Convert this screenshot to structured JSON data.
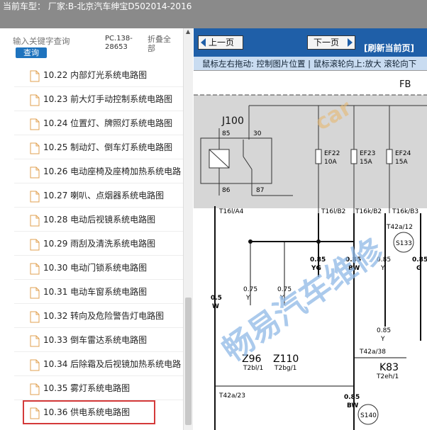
{
  "header": {
    "title": "当前车型：  厂家:B-北京汽车绅宝D502014-2016"
  },
  "search": {
    "placeholder": "输入关键字查询",
    "button": "查询",
    "pc_label": "PC.138-28653",
    "fold_label": "折叠全部"
  },
  "tree": {
    "items": [
      {
        "label": "10.22  内部灯光系统电路图"
      },
      {
        "label": "10.23  前大灯手动控制系统电路图"
      },
      {
        "label": "10.24  位置灯、牌照灯系统电路图"
      },
      {
        "label": "10.25  制动灯、倒车灯系统电路图"
      },
      {
        "label": "10.26  电动座椅及座椅加热系统电路"
      },
      {
        "label": "10.27  喇叭、点烟器系统电路图"
      },
      {
        "label": "10.28  电动后视镜系统电路图"
      },
      {
        "label": "10.29  雨刮及清洗系统电路图"
      },
      {
        "label": "10.30  电动门锁系统电路图"
      },
      {
        "label": "10.31  电动车窗系统电路图"
      },
      {
        "label": "10.32  转向及危险警告灯电路图"
      },
      {
        "label": "10.33  倒车雷达系统电路图"
      },
      {
        "label": "10.34  后除霜及后视镜加热系统电路"
      },
      {
        "label": "10.35  雾灯系统电路图"
      },
      {
        "label": "10.36  供电系统电路图"
      }
    ],
    "selected_index": 14
  },
  "viewer": {
    "prev": "上一页",
    "next": "下一页",
    "refresh": "[刷新当前页]",
    "hint": "鼠标左右拖动: 控制图片位置 | 鼠标滚轮向上:放大  滚轮向下"
  },
  "diagram": {
    "fb": "FB",
    "relay": "J100",
    "relay_pins": [
      "85",
      "30",
      "86",
      "87"
    ],
    "fuses": [
      {
        "name": "EF22",
        "rating": "10A"
      },
      {
        "name": "EF23",
        "rating": "15A"
      },
      {
        "name": "EF24",
        "rating": "15A"
      }
    ],
    "connectors": [
      "T16l/A4",
      "T16l/B2",
      "T16k/B2",
      "T16k/B3",
      "T42a/12",
      "T42a/38",
      "T42a/23",
      "T2bl/1",
      "T2bg/1",
      "T2eh/1"
    ],
    "wires": [
      {
        "gauge": "0.5",
        "color": "W"
      },
      {
        "gauge": "0.75",
        "color": "Y"
      },
      {
        "gauge": "0.75",
        "color": "Y"
      },
      {
        "gauge": "0.85",
        "color": "YG"
      },
      {
        "gauge": "0.85",
        "color": "BW"
      },
      {
        "gauge": "0.85",
        "color": "Y"
      },
      {
        "gauge": "0.85",
        "color": "G"
      },
      {
        "gauge": "0.85",
        "color": "Y"
      },
      {
        "gauge": "0.85",
        "color": "BW"
      }
    ],
    "components": [
      "Z96",
      "Z110",
      "K83"
    ],
    "splices": [
      "S133",
      "S140"
    ],
    "watermark_cn": "畅易汽车维修",
    "watermark_en": "car"
  }
}
